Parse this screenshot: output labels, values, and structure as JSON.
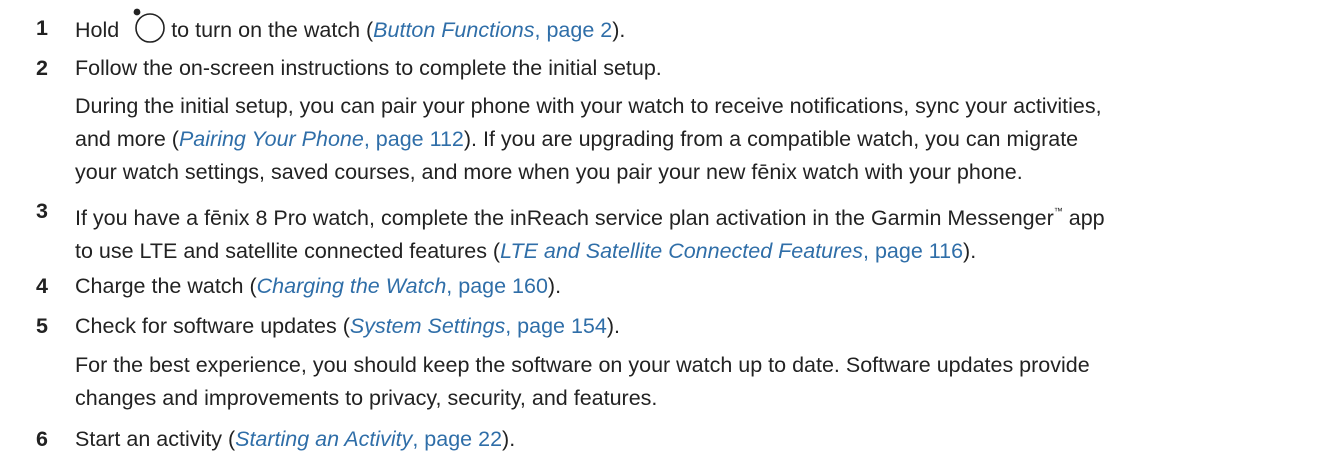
{
  "steps": [
    {
      "num": "1",
      "before": "Hold",
      "icon": "watch-button-icon",
      "middle": "to turn on the watch (",
      "link_title": "Button Functions",
      "link_page": ", page 2",
      "after": ")."
    },
    {
      "num": "2",
      "text": "Follow the on-screen instructions to complete the initial setup.",
      "note_line1": "During the initial setup, you can pair your phone with your watch to receive notifications, sync your activities,",
      "note_line2_before": "and more (",
      "note_link_title": "Pairing Your Phone",
      "note_link_page": ", page 112",
      "note_line2_after": "). If you are upgrading from a compatible watch, you can migrate",
      "note_line3": "your watch settings, saved courses, and more when you pair your new fēnix watch with your phone."
    },
    {
      "num": "3",
      "line1": "If you have a fēnix 8 Pro watch, complete the inReach service plan activation in the Garmin Messenger",
      "tm": "™",
      "line1_after": " app",
      "line2_before": "to use LTE and satellite connected features (",
      "link_title": "LTE and Satellite Connected Features",
      "link_page": ", page 116",
      "after": ")."
    },
    {
      "num": "4",
      "before": "Charge the watch (",
      "link_title": "Charging the Watch",
      "link_page": ", page 160",
      "after": ")."
    },
    {
      "num": "5",
      "before": "Check for software updates (",
      "link_title": "System Settings",
      "link_page": ", page 154",
      "after": ").",
      "note_line1": "For the best experience, you should keep the software on your watch up to date. Software updates provide",
      "note_line2": "changes and improvements to privacy, security, and features."
    },
    {
      "num": "6",
      "before": "Start an activity (",
      "link_title": "Starting an Activity",
      "link_page": ", page 22",
      "after": ")."
    }
  ]
}
